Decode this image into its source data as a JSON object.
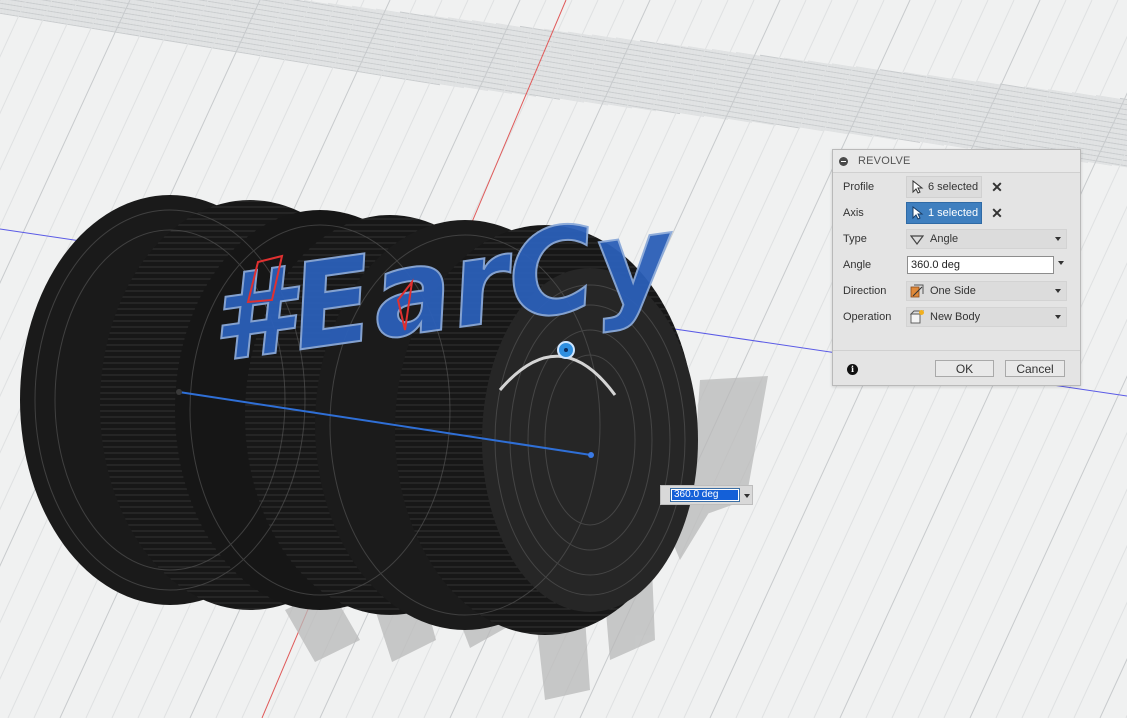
{
  "canvas": {
    "label_text": "#EarCy",
    "colors": {
      "background": "#f0f1f1",
      "grid_minor": "#dfe1e2",
      "grid_major": "#c8cbcd",
      "axis_red": "#e05050",
      "axis_blue": "#4a4ae0",
      "profile_fill": "#2b5fb8",
      "revolve_body": "#141414"
    }
  },
  "dialog": {
    "title": "REVOLVE",
    "profile": {
      "label": "Profile",
      "value": "6 selected"
    },
    "axis": {
      "label": "Axis",
      "value": "1 selected"
    },
    "type": {
      "label": "Type",
      "value": "Angle",
      "icon": "angle-icon"
    },
    "angle": {
      "label": "Angle",
      "value": "360.0 deg"
    },
    "direction": {
      "label": "Direction",
      "value": "One Side",
      "icon": "one-side-icon"
    },
    "operation": {
      "label": "Operation",
      "value": "New Body",
      "icon": "new-body-icon"
    },
    "ok_label": "OK",
    "cancel_label": "Cancel"
  },
  "manipulator": {
    "value": "360.0 deg"
  }
}
